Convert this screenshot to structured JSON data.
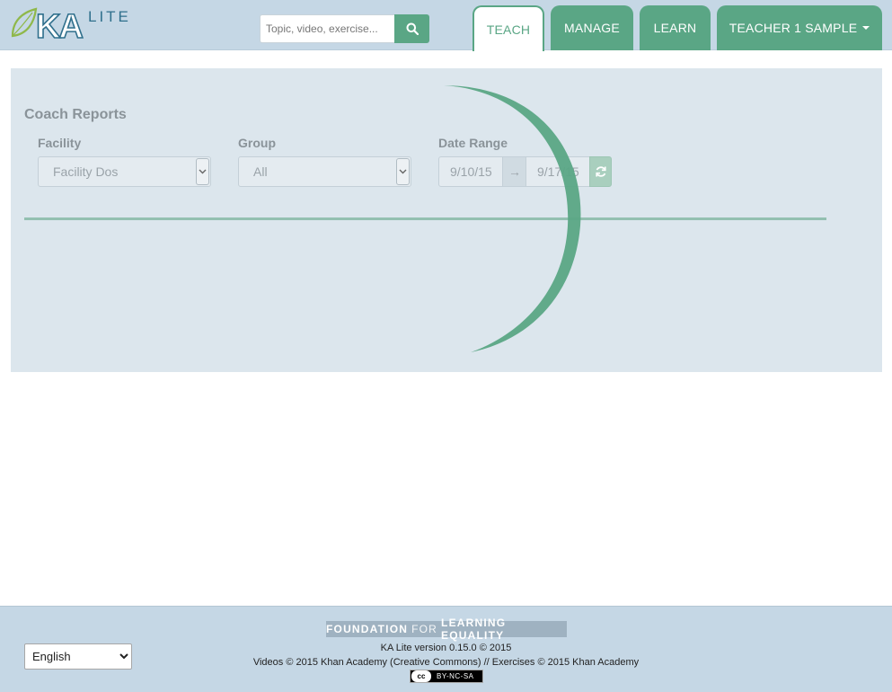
{
  "header": {
    "logo": {
      "text_ka": "KA",
      "text_lite": "LITE"
    },
    "search": {
      "placeholder": "Topic, video, exercise..."
    },
    "nav": {
      "teach": "TEACH",
      "manage": "MANAGE",
      "learn": "LEARN",
      "user": "TEACHER 1 SAMPLE"
    }
  },
  "main": {
    "title": "Coach Reports",
    "facility": {
      "label": "Facility",
      "value": "Facility Dos"
    },
    "group": {
      "label": "Group",
      "value": "All"
    },
    "date_range": {
      "label": "Date Range",
      "start": "9/10/15",
      "separator": "→",
      "end": "9/17/15"
    }
  },
  "footer": {
    "language": {
      "selected": "English"
    },
    "fle": {
      "part1": "FOUNDATION",
      "part2": "FOR",
      "part3": "LEARNING EQUALITY"
    },
    "version": "KA Lite version 0.15.0 © 2015",
    "credits": "Videos © 2015 Khan Academy (Creative Commons) // Exercises © 2015 Khan Academy",
    "license": {
      "cc": "cc",
      "text": "BY-NC-SA"
    }
  },
  "colors": {
    "accent": "#5aa685",
    "header_bg": "#c5d7e5",
    "panel_bg": "#dce6ed"
  }
}
